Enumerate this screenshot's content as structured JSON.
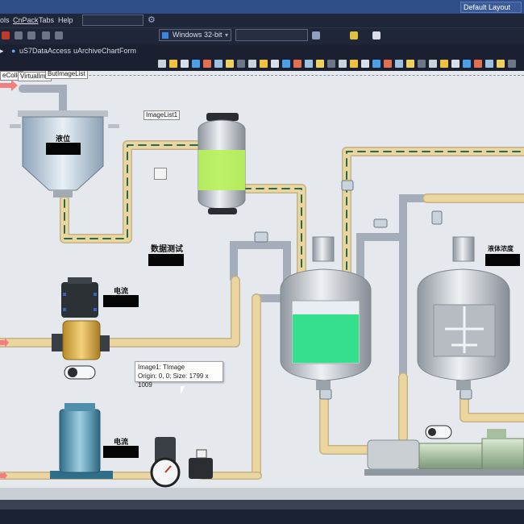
{
  "window": {
    "layout_name": "Default Layout"
  },
  "menu": {
    "items": [
      "ols",
      "CnPack",
      "Tabs",
      "Help"
    ]
  },
  "toolbar": {
    "platform": "Windows 32-bit"
  },
  "tabs": [
    "uS7DataAccess",
    "uArchiveChartForm"
  ],
  "component_labels": {
    "collection": "eColle",
    "virtual_image": "VirtualIma",
    "image_list": "ButImageList",
    "image_list1": "ImageList1"
  },
  "canvas_labels": {
    "level": "液位",
    "data_test": "数据测试",
    "current1": "电流",
    "current2": "电流",
    "concentration": "液体浓度"
  },
  "tooltip": {
    "line1": "Image1: TImage",
    "line2": "Origin: 0, 0; Size: 1799 x 1009"
  },
  "colors": {
    "canvas_bg": "#e5e9ee",
    "pipe_tan": "#ecd6a0",
    "pipe_gray": "#a9b0bd",
    "liquid_green": "#34e08c",
    "liquid_lime": "#b8f25a",
    "ide_dark": "#1f2638",
    "title_blue": "#2f4d88"
  }
}
